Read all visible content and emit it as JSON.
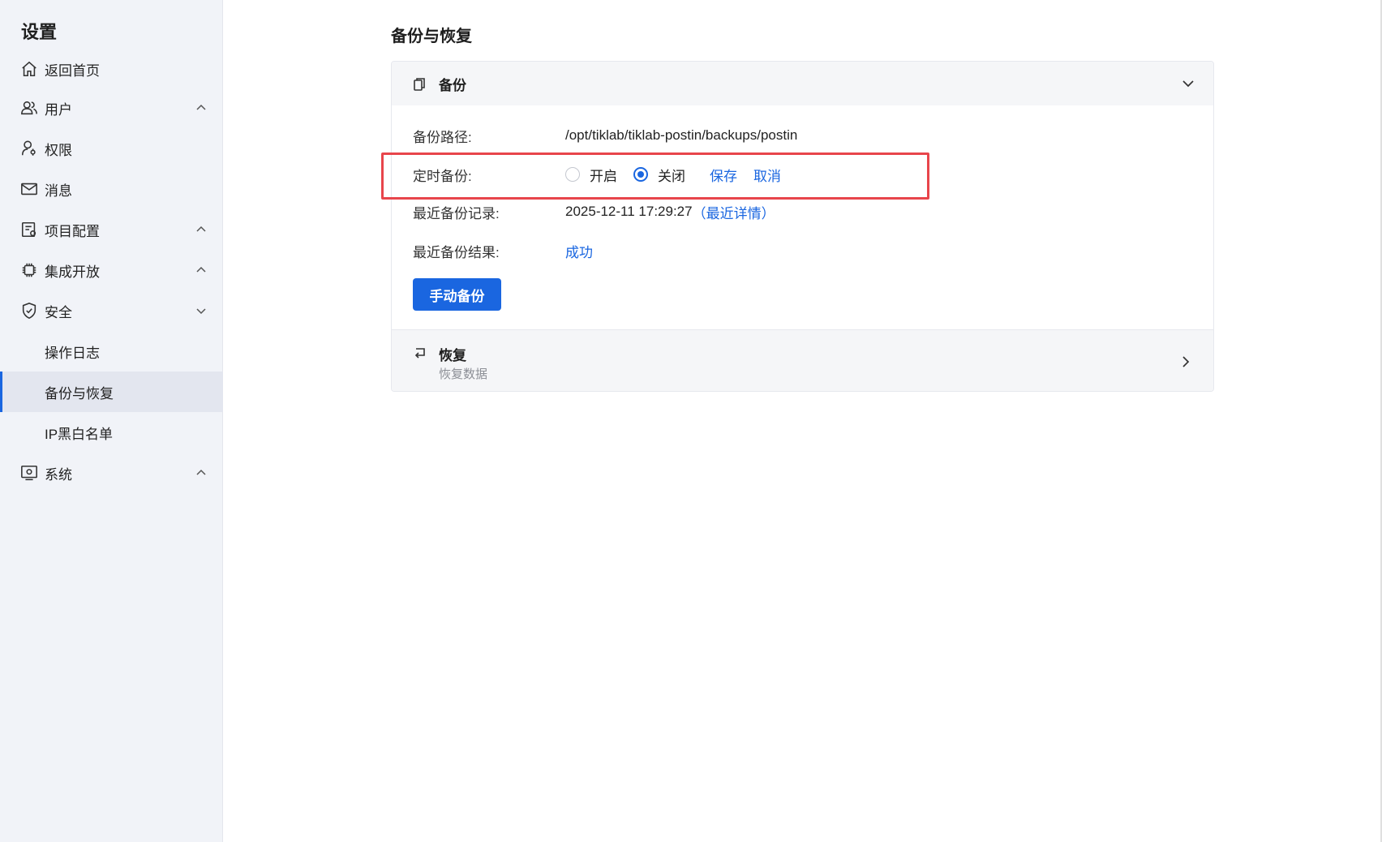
{
  "sidebar": {
    "title": "设置",
    "items": [
      {
        "label": "返回首页",
        "icon": "home-icon"
      },
      {
        "label": "用户",
        "icon": "users-icon",
        "chevron": "up"
      },
      {
        "label": "权限",
        "icon": "user-permission-icon"
      },
      {
        "label": "消息",
        "icon": "mail-icon"
      },
      {
        "label": "项目配置",
        "icon": "project-config-icon",
        "chevron": "up"
      },
      {
        "label": "集成开放",
        "icon": "chip-icon",
        "chevron": "up"
      },
      {
        "label": "安全",
        "icon": "shield-icon",
        "chevron": "down"
      },
      {
        "label": "操作日志"
      },
      {
        "label": "备份与恢复",
        "active": true
      },
      {
        "label": "IP黑白名单"
      },
      {
        "label": "系统",
        "icon": "system-icon",
        "chevron": "up"
      }
    ]
  },
  "main": {
    "title": "备份与恢复",
    "backup": {
      "header": "备份",
      "path_label": "备份路径:",
      "path_value": "/opt/tiklab/tiklab-postin/backups/postin",
      "schedule_label": "定时备份:",
      "option_on": "开启",
      "option_off": "关闭",
      "selected": "关闭",
      "save": "保存",
      "cancel": "取消",
      "last_record_label": "最近备份记录:",
      "last_record_time": "2025-12-11 17:29:27",
      "last_record_link": "（最近详情）",
      "last_result_label": "最近备份结果:",
      "last_result_value": "成功",
      "manual_button": "手动备份"
    },
    "restore": {
      "title": "恢复",
      "subtitle": "恢复数据"
    }
  },
  "colors": {
    "accent": "#1a66e0",
    "highlight": "#e8454b",
    "sidebar_bg": "#f1f3f8"
  }
}
